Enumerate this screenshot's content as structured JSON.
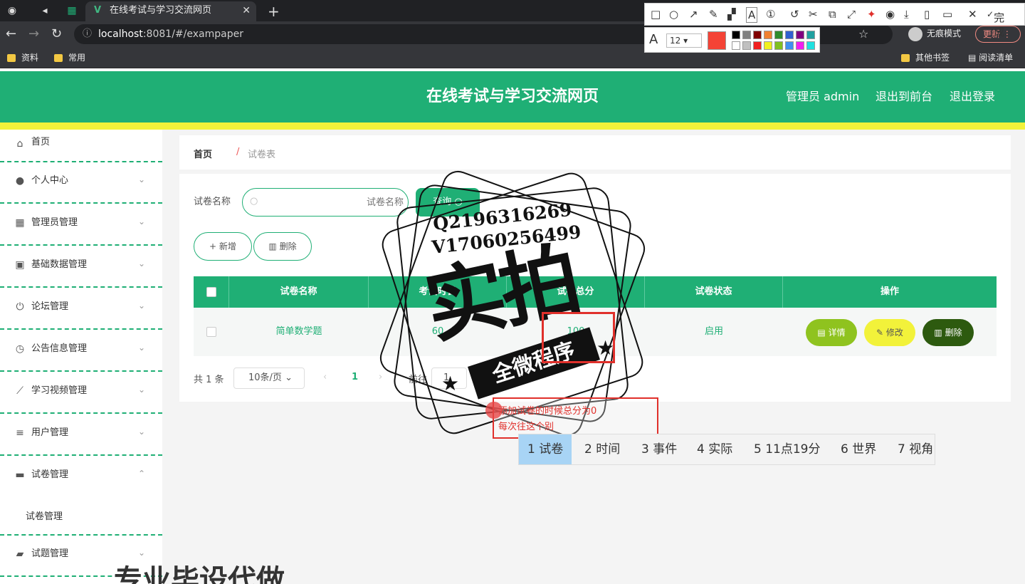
{
  "browser": {
    "tab_title": "在线考试与学习交流网页",
    "url_host": "localhost",
    "url_rest": ":8081/#/exampaper",
    "incognito_label": "无痕模式",
    "update_label": "更新",
    "bookmarks": [
      "资料",
      "常用"
    ],
    "bookmarks_right": [
      "其他书签",
      "阅读清单"
    ]
  },
  "annotation_toolbar": {
    "done_label": "完成",
    "font_size": "12",
    "current_color": "#f44336",
    "palette": [
      "#000000",
      "#808080",
      "#800000",
      "#f08030",
      "#2e8b2e",
      "#3060d0",
      "#800080",
      "#20a0a0",
      "#ffffff",
      "#c0c0c0",
      "#f02020",
      "#f0f020",
      "#80c020",
      "#4090f0",
      "#f020f0",
      "#20e0e0"
    ]
  },
  "header": {
    "title": "在线考试与学习交流网页",
    "admin_label": "管理员 admin",
    "front_label": "退出到前台",
    "logout_label": "退出登录",
    "brand_color": "#1faf75"
  },
  "sidebar": {
    "items": [
      {
        "label": "首页",
        "icon": "home-icon",
        "arrow": ""
      },
      {
        "label": "个人中心",
        "icon": "user-icon",
        "arrow": "⌄"
      },
      {
        "label": "管理员管理",
        "icon": "grid-icon",
        "arrow": "⌄"
      },
      {
        "label": "基础数据管理",
        "icon": "clipboard-icon",
        "arrow": "⌄"
      },
      {
        "label": "论坛管理",
        "icon": "power-icon",
        "arrow": "⌄"
      },
      {
        "label": "公告信息管理",
        "icon": "clock-icon",
        "arrow": "⌄"
      },
      {
        "label": "学习视频管理",
        "icon": "chart-icon",
        "arrow": "⌄"
      },
      {
        "label": "用户管理",
        "icon": "list-icon",
        "arrow": "⌄"
      },
      {
        "label": "试卷管理",
        "icon": "chat-icon",
        "arrow": "⌃"
      },
      {
        "label": "试题管理",
        "icon": "folder-icon",
        "arrow": "⌄"
      }
    ],
    "submenu_label": "试卷管理"
  },
  "breadcrumb": {
    "home": "首页",
    "separator": "/",
    "current": "试卷表"
  },
  "search": {
    "label": "试卷名称",
    "placeholder": "试卷名称",
    "button": "查询"
  },
  "actions": {
    "add": "新增",
    "delete": "删除"
  },
  "table": {
    "headers": [
      "试卷名称",
      "考试时长",
      "试卷总分",
      "试卷状态",
      "操作"
    ],
    "rows": [
      {
        "name": "简单数学题",
        "duration": "60",
        "score": "100",
        "status": "启用"
      }
    ],
    "row_actions": {
      "detail": "详情",
      "edit": "修改",
      "delete": "删除"
    }
  },
  "pagination": {
    "total": "共 1 条",
    "page_size": "10条/页",
    "current_page": "1",
    "goto_label": "前往",
    "goto_value": "1"
  },
  "overlay": {
    "stamp_qq": "Q2196316269",
    "stamp_v": "V17060256499",
    "stamp_big": "实拍",
    "stamp_banner": "全微程序",
    "note_line1": "添加试卷的时候总分为0",
    "note_line2": "每次往这个别",
    "ime_candidates": [
      "1 试卷",
      "2 时间",
      "3 事件",
      "4 实际",
      "5 11点19分",
      "6 世界",
      "7 视角"
    ],
    "watermark": "专业毕设代做"
  }
}
